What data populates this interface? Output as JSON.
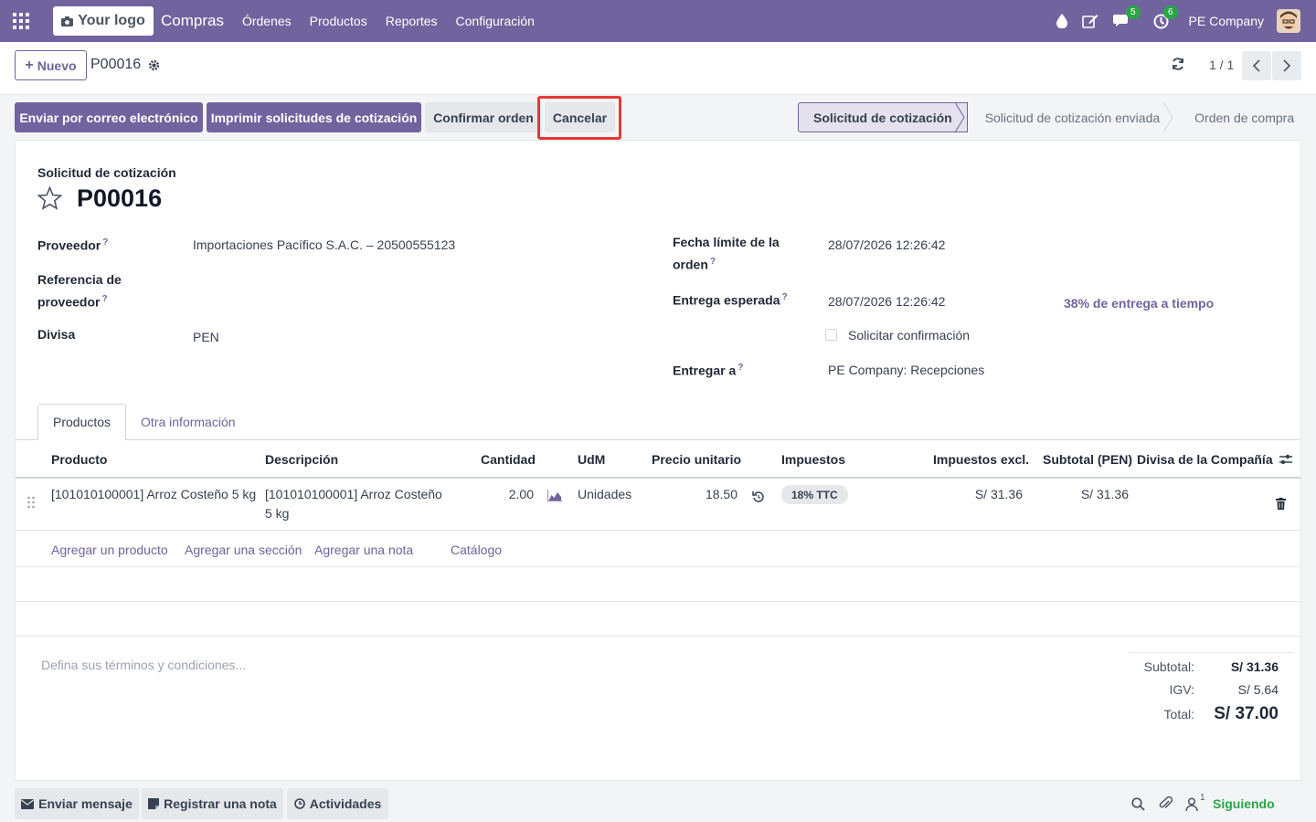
{
  "navbar": {
    "logo_text": "Your logo",
    "app_name": "Compras",
    "menu": [
      "Órdenes",
      "Productos",
      "Reportes",
      "Configuración"
    ],
    "messages_count": "5",
    "activities_count": "6",
    "company": "PE Company"
  },
  "control_panel": {
    "new_button": "Nuevo",
    "record_name": "P00016",
    "pager": "1 / 1"
  },
  "actions": {
    "send_email": "Enviar por correo electrónico",
    "print_rfq": "Imprimir solicitudes de cotización",
    "confirm": "Confirmar orden",
    "cancel": "Cancelar"
  },
  "status_stages": [
    "Solicitud de cotización",
    "Solicitud de cotización enviada",
    "Orden de compra"
  ],
  "form": {
    "subtitle": "Solicitud de cotización",
    "title": "P00016",
    "vendor_label": "Proveedor",
    "vendor_value": "Importaciones Pacífico S.A.C. – 20500555123",
    "vendor_ref_label_1": "Referencia de",
    "vendor_ref_label_2": "proveedor",
    "currency_label": "Divisa",
    "currency_value": "PEN",
    "deadline_label_1": "Fecha límite de la",
    "deadline_label_2": "orden",
    "deadline_value": "28/07/2026 12:26:42",
    "expected_label": "Entrega esperada",
    "expected_value": "28/07/2026 12:26:42",
    "on_time": "38% de entrega a tiempo",
    "ask_confirm": "Solicitar confirmación",
    "deliver_to_label": "Entregar a",
    "deliver_to_value": "PE Company: Recepciones"
  },
  "tabs": [
    "Productos",
    "Otra información"
  ],
  "table": {
    "headers": [
      "Producto",
      "Descripción",
      "Cantidad",
      "UdM",
      "Precio unitario",
      "Impuestos",
      "Impuestos excl.",
      "Subtotal (PEN)",
      "Divisa de la Compañía"
    ],
    "row": {
      "product": "[101010100001] Arroz Costeño 5 kg",
      "description_1": "[101010100001] Arroz Costeño",
      "description_2": "5 kg",
      "quantity": "2.00",
      "uom": "Unidades",
      "price": "18.50",
      "tax": "18% TTC",
      "tax_excl": "S/ 31.36",
      "subtotal": "S/ 31.36"
    },
    "add_links": [
      "Agregar un producto",
      "Agregar una sección",
      "Agregar una nota",
      "Catálogo"
    ]
  },
  "terms_placeholder": "Defina sus términos y condiciones...",
  "totals": {
    "subtotal_label": "Subtotal:",
    "subtotal_value": "S/ 31.36",
    "tax_label": "IGV:",
    "tax_value": "S/ 5.64",
    "total_label": "Total:",
    "total_value": "S/ 37.00"
  },
  "chatter": {
    "send_message": "Enviar mensaje",
    "log_note": "Registrar una nota",
    "activities": "Actividades",
    "followers_count": "1",
    "following": "Siguiendo"
  },
  "colors": {
    "brand": "#71639e",
    "highlight": "#e53935",
    "follow": "#28a745"
  }
}
